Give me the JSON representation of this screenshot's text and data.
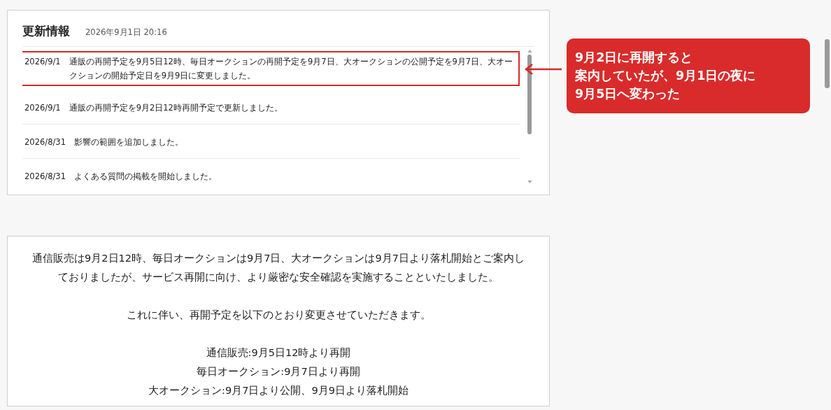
{
  "updates": {
    "title": "更新情報",
    "timestamp": "2026年9月1日 20:16",
    "rows": [
      {
        "date": "2026/9/1",
        "text": "通販の再開予定を9月5日12時、毎日オークションの再開予定を9月7日、大オークションの公開予定を9月7日、大オークションの開始予定日を9月9日に変更しました。",
        "highlighted": true
      },
      {
        "date": "2026/9/1",
        "text": "通販の再開予定を9月2日12時再開予定で更新しました。",
        "highlighted": false
      },
      {
        "date": "2026/8/31",
        "text": "影響の範囲を追加しました。",
        "highlighted": false
      },
      {
        "date": "2026/8/31",
        "text": "よくある質問の掲載を開始しました。",
        "highlighted": false
      }
    ]
  },
  "callout": {
    "lines": [
      "9月2日に再開すると",
      "案内していたが、9月1日の夜に",
      "9月5日へ変わった"
    ]
  },
  "notice": {
    "paragraphs": [
      [
        "通信販売は9月2日12時、毎日オークションは9月7日、大オークションは9月7日より落札開始とご案内しておりましたが、サービス再開に向け、より厳密な安全確認を実施することといたしました。"
      ],
      [
        "これに伴い、再開予定を以下のとおり変更させていただきます。"
      ],
      [
        "通信販売:9月5日12時より再開",
        "毎日オークション:9月7日より再開",
        "大オークション:9月7日より公開、9月9日より落札開始"
      ]
    ]
  }
}
